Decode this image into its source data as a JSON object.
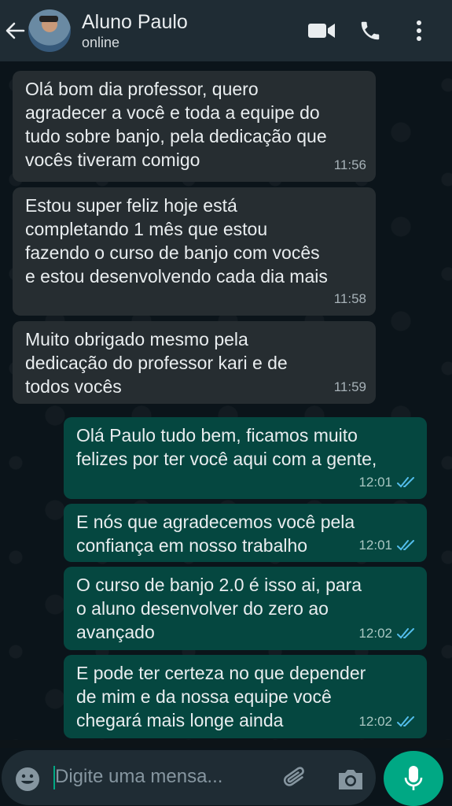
{
  "header": {
    "contact_name": "Aluno Paulo",
    "status": "online",
    "icons": [
      "back-arrow-icon",
      "avatar",
      "video-call-icon",
      "phone-icon",
      "more-options-icon"
    ],
    "background": "#1f2c34"
  },
  "messages": [
    {
      "direction": "incoming",
      "text": "Olá bom dia professor, quero\nagradecer a você e toda a equipe do\ntudo sobre banjo, pela dedicação que\nvocês  tiveram comigo",
      "time": "11:56"
    },
    {
      "direction": "incoming",
      "text": "Estou super feliz hoje está\ncompletando 1 mês  que estou\nfazendo o curso de banjo com vocês\ne estou desenvolvendo cada dia mais",
      "time": "11:58"
    },
    {
      "direction": "incoming",
      "text": "Muito obrigado mesmo pela\ndedicação do professor kari e de\ntodos vocês",
      "time": "11:59"
    },
    {
      "direction": "outgoing",
      "text": "Olá Paulo tudo bem, ficamos muito\nfelizes por ter você aqui com a gente,",
      "time": "12:01",
      "read": true
    },
    {
      "direction": "outgoing",
      "text": "E nós que agradecemos você pela\nconfiança em nosso trabalho",
      "time": "12:01",
      "read": true
    },
    {
      "direction": "outgoing",
      "text": "O curso de banjo 2.0 é isso ai, para\no aluno desenvolver do zero ao\navançado",
      "time": "12:02",
      "read": true
    },
    {
      "direction": "outgoing",
      "text": "E pode ter certeza no que depender\nde mim e da nossa equipe você\nchegará mais longe ainda",
      "time": "12:02",
      "read": true
    }
  ],
  "composer": {
    "placeholder": "Digite uma mensa...",
    "icons": [
      "emoji-icon",
      "attach-icon",
      "camera-icon",
      "mic-icon"
    ],
    "accent": "#00a884"
  },
  "colors": {
    "incoming_bubble": "#262d31",
    "outgoing_bubble": "#054740",
    "read_ticks": "#53bdeb"
  }
}
